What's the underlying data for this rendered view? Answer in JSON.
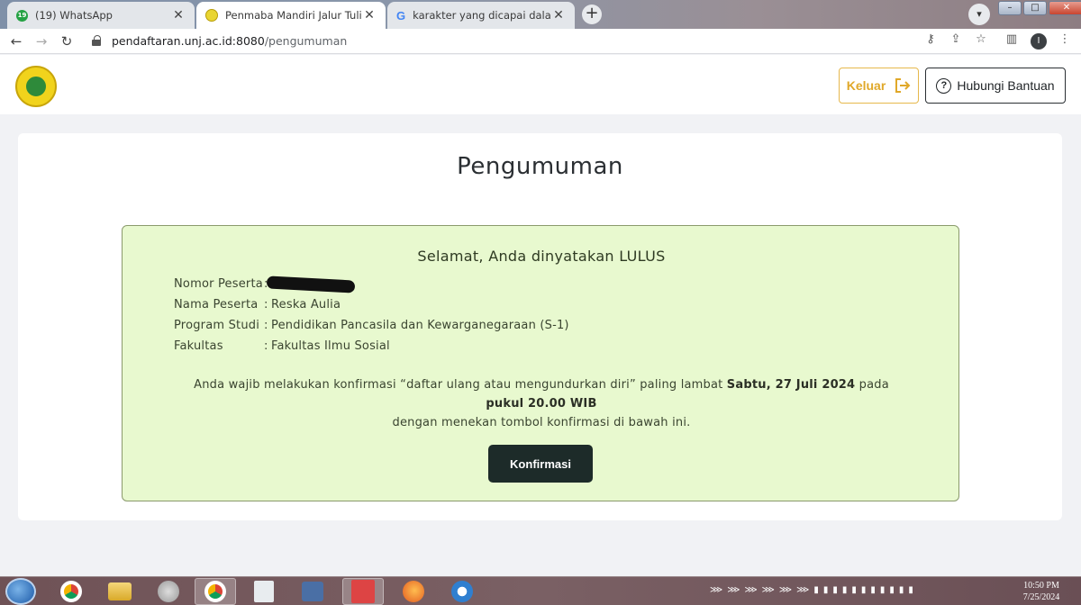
{
  "browser": {
    "tabs": [
      {
        "title": "(19) WhatsApp",
        "badge": "19",
        "close": "✕",
        "active": false
      },
      {
        "title": "Penmaba Mandiri Jalur Tulis",
        "close": "✕",
        "active": true
      },
      {
        "title": "karakter yang dicapai dalam rpp",
        "close": "✕",
        "active": false
      }
    ],
    "new_tab": "+",
    "url_host": "pendaftaran.unj.ac.id:8080",
    "url_path": "/pengumuman",
    "profile_initial": "I"
  },
  "header": {
    "logout_label": "Keluar",
    "help_label": "Hubungi Bantuan",
    "help_icon_glyph": "?"
  },
  "main": {
    "title": "Pengumuman",
    "result": {
      "heading": "Selamat, Anda dinyatakan LULUS",
      "fields": [
        {
          "label": "Nomor Peserta",
          "sep": ":",
          "value": ""
        },
        {
          "label": "Nama Peserta",
          "sep": ":",
          "value": "Reska Aulia"
        },
        {
          "label": "Program Studi",
          "sep": ":",
          "value": "Pendidikan Pancasila dan Kewarganegaraan (S-1)"
        },
        {
          "label": "Fakultas",
          "sep": ":",
          "value": "Fakultas Ilmu Sosial"
        }
      ],
      "notice_prefix": "Anda wajib melakukan konfirmasi “daftar ulang atau mengundurkan diri” paling lambat ",
      "notice_date": "Sabtu, 27 Juli 2024",
      "notice_mid": " pada",
      "notice_time": "pukul 20.00 WIB",
      "notice_suffix": "dengan menekan tombol konfirmasi di bawah ini.",
      "confirm_label": "Konfirmasi"
    }
  },
  "taskbar": {
    "time": "10:50 PM",
    "date": "7/25/2024"
  },
  "colors": {
    "result_bg": "#e8f9cf",
    "confirm_bg": "#1d2b29",
    "logout_accent": "#e0a829"
  }
}
